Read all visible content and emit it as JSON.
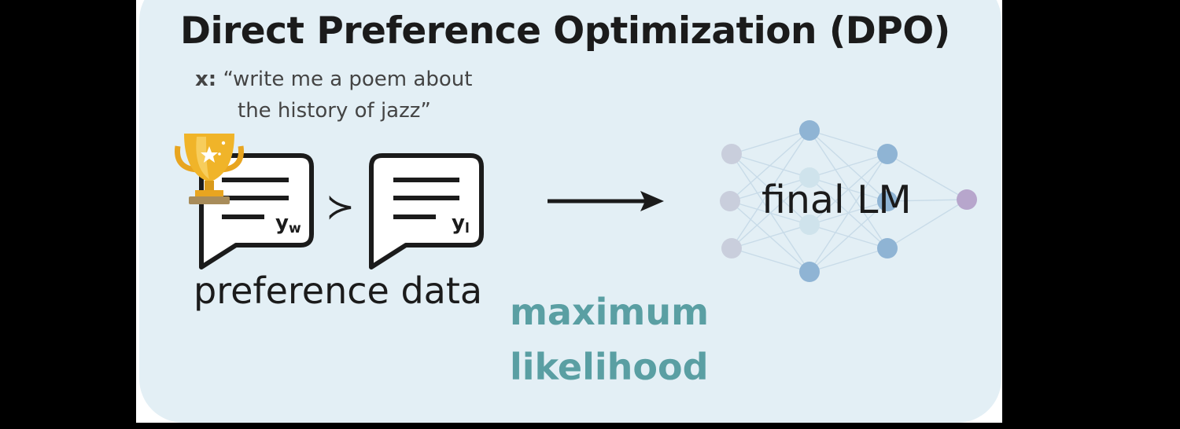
{
  "title": "Direct Preference Optimization (DPO)",
  "prompt": {
    "label": "x:",
    "line1": "“write me a poem about",
    "line2": "the history of jazz”"
  },
  "responses": {
    "winner_label": "y",
    "winner_sub": "w",
    "loser_label": "y",
    "loser_sub": "l",
    "comparator": "≻"
  },
  "preference_caption": "preference data",
  "objective": {
    "line1": "maximum",
    "line2": "likelihood"
  },
  "model_label": "final LM",
  "colors": {
    "panel": "#e3eff5",
    "objective_text": "#5a9fa3",
    "trophy": "#f0b429",
    "node_blue": "#8fb4d4",
    "node_grey": "#c9cedc",
    "node_purple": "#b7a6cc"
  },
  "icons": [
    "trophy-icon",
    "speech-bubble-icon",
    "arrow-right-icon",
    "neural-network-icon"
  ]
}
